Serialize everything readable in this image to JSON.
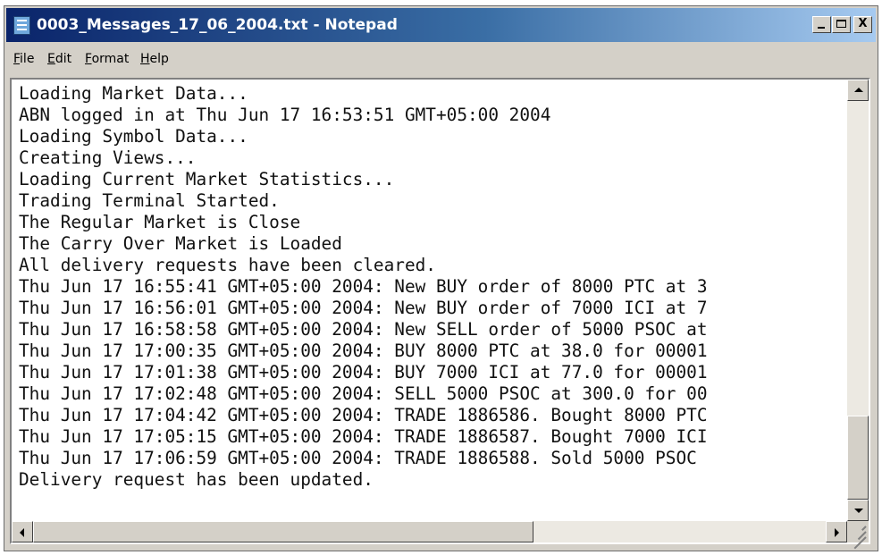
{
  "window": {
    "title": "0003_Messages_17_06_2004.txt - Notepad",
    "icon": "notepad-icon",
    "controls": [
      "minimize-icon",
      "maximize-icon",
      "close-icon"
    ],
    "close_glyph": "X"
  },
  "menu": {
    "items": [
      "File",
      "Edit",
      "Format",
      "Help"
    ]
  },
  "document": {
    "lines": [
      "Loading Market Data...",
      "ABN logged in at Thu Jun 17 16:53:51 GMT+05:00 2004",
      "Loading Symbol Data...",
      "Creating Views...",
      "Loading Current Market Statistics...",
      "Trading Terminal Started.",
      "The Regular Market is Close",
      "The Carry Over Market is Loaded",
      "All delivery requests have been cleared.",
      "Thu Jun 17 16:55:41 GMT+05:00 2004: New BUY order of 8000 PTC at 3",
      "Thu Jun 17 16:56:01 GMT+05:00 2004: New BUY order of 7000 ICI at 7",
      "Thu Jun 17 16:58:58 GMT+05:00 2004: New SELL order of 5000 PSOC at",
      "Thu Jun 17 17:00:35 GMT+05:00 2004: BUY 8000 PTC at 38.0 for 00001",
      "Thu Jun 17 17:01:38 GMT+05:00 2004: BUY 7000 ICI at 77.0 for 00001",
      "Thu Jun 17 17:02:48 GMT+05:00 2004: SELL 5000 PSOC at 300.0 for 00",
      "Thu Jun 17 17:04:42 GMT+05:00 2004: TRADE 1886586. Bought 8000 PTC",
      "Thu Jun 17 17:05:15 GMT+05:00 2004: TRADE 1886587. Bought 7000 ICI",
      "Thu Jun 17 17:06:59 GMT+05:00 2004: TRADE 1886588. Sold 5000 PSOC",
      "Delivery request has been updated."
    ]
  },
  "scrollbars": {
    "vertical_position": 0.85,
    "horizontal_position": 0.0
  },
  "colors": {
    "title_start": "#0a246a",
    "title_end": "#a6caf0",
    "chrome": "#d4d0c8"
  }
}
